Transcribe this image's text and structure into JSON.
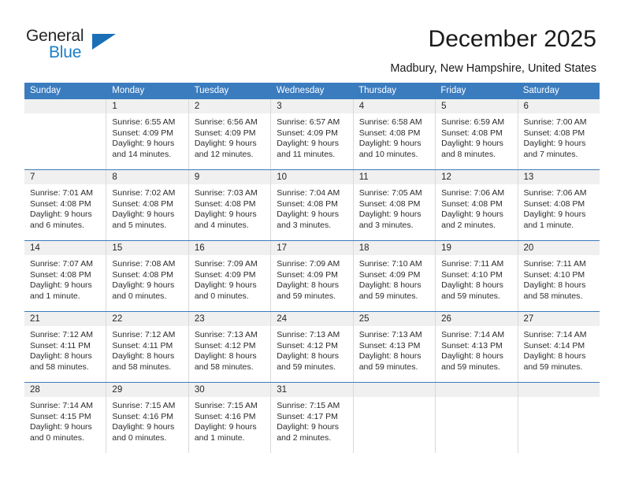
{
  "brand": {
    "name_top": "General",
    "name_bottom": "Blue",
    "accent_color": "#1a7ec8",
    "triangle_color": "#1a6fb5"
  },
  "header": {
    "title": "December 2025",
    "subtitle": "Madbury, New Hampshire, United States",
    "header_bg": "#3b7cbf"
  },
  "weekdays": [
    "Sunday",
    "Monday",
    "Tuesday",
    "Wednesday",
    "Thursday",
    "Friday",
    "Saturday"
  ],
  "labels": {
    "sunrise": "Sunrise:",
    "sunset": "Sunset:",
    "daylight": "Daylight:"
  },
  "weeks": [
    [
      {
        "day": "",
        "blank": true
      },
      {
        "day": "1",
        "sunrise": "Sunrise: 6:55 AM",
        "sunset": "Sunset: 4:09 PM",
        "daylight1": "Daylight: 9 hours",
        "daylight2": "and 14 minutes."
      },
      {
        "day": "2",
        "sunrise": "Sunrise: 6:56 AM",
        "sunset": "Sunset: 4:09 PM",
        "daylight1": "Daylight: 9 hours",
        "daylight2": "and 12 minutes."
      },
      {
        "day": "3",
        "sunrise": "Sunrise: 6:57 AM",
        "sunset": "Sunset: 4:09 PM",
        "daylight1": "Daylight: 9 hours",
        "daylight2": "and 11 minutes."
      },
      {
        "day": "4",
        "sunrise": "Sunrise: 6:58 AM",
        "sunset": "Sunset: 4:08 PM",
        "daylight1": "Daylight: 9 hours",
        "daylight2": "and 10 minutes."
      },
      {
        "day": "5",
        "sunrise": "Sunrise: 6:59 AM",
        "sunset": "Sunset: 4:08 PM",
        "daylight1": "Daylight: 9 hours",
        "daylight2": "and 8 minutes."
      },
      {
        "day": "6",
        "sunrise": "Sunrise: 7:00 AM",
        "sunset": "Sunset: 4:08 PM",
        "daylight1": "Daylight: 9 hours",
        "daylight2": "and 7 minutes."
      }
    ],
    [
      {
        "day": "7",
        "sunrise": "Sunrise: 7:01 AM",
        "sunset": "Sunset: 4:08 PM",
        "daylight1": "Daylight: 9 hours",
        "daylight2": "and 6 minutes."
      },
      {
        "day": "8",
        "sunrise": "Sunrise: 7:02 AM",
        "sunset": "Sunset: 4:08 PM",
        "daylight1": "Daylight: 9 hours",
        "daylight2": "and 5 minutes."
      },
      {
        "day": "9",
        "sunrise": "Sunrise: 7:03 AM",
        "sunset": "Sunset: 4:08 PM",
        "daylight1": "Daylight: 9 hours",
        "daylight2": "and 4 minutes."
      },
      {
        "day": "10",
        "sunrise": "Sunrise: 7:04 AM",
        "sunset": "Sunset: 4:08 PM",
        "daylight1": "Daylight: 9 hours",
        "daylight2": "and 3 minutes."
      },
      {
        "day": "11",
        "sunrise": "Sunrise: 7:05 AM",
        "sunset": "Sunset: 4:08 PM",
        "daylight1": "Daylight: 9 hours",
        "daylight2": "and 3 minutes."
      },
      {
        "day": "12",
        "sunrise": "Sunrise: 7:06 AM",
        "sunset": "Sunset: 4:08 PM",
        "daylight1": "Daylight: 9 hours",
        "daylight2": "and 2 minutes."
      },
      {
        "day": "13",
        "sunrise": "Sunrise: 7:06 AM",
        "sunset": "Sunset: 4:08 PM",
        "daylight1": "Daylight: 9 hours",
        "daylight2": "and 1 minute."
      }
    ],
    [
      {
        "day": "14",
        "sunrise": "Sunrise: 7:07 AM",
        "sunset": "Sunset: 4:08 PM",
        "daylight1": "Daylight: 9 hours",
        "daylight2": "and 1 minute."
      },
      {
        "day": "15",
        "sunrise": "Sunrise: 7:08 AM",
        "sunset": "Sunset: 4:08 PM",
        "daylight1": "Daylight: 9 hours",
        "daylight2": "and 0 minutes."
      },
      {
        "day": "16",
        "sunrise": "Sunrise: 7:09 AM",
        "sunset": "Sunset: 4:09 PM",
        "daylight1": "Daylight: 9 hours",
        "daylight2": "and 0 minutes."
      },
      {
        "day": "17",
        "sunrise": "Sunrise: 7:09 AM",
        "sunset": "Sunset: 4:09 PM",
        "daylight1": "Daylight: 8 hours",
        "daylight2": "and 59 minutes."
      },
      {
        "day": "18",
        "sunrise": "Sunrise: 7:10 AM",
        "sunset": "Sunset: 4:09 PM",
        "daylight1": "Daylight: 8 hours",
        "daylight2": "and 59 minutes."
      },
      {
        "day": "19",
        "sunrise": "Sunrise: 7:11 AM",
        "sunset": "Sunset: 4:10 PM",
        "daylight1": "Daylight: 8 hours",
        "daylight2": "and 59 minutes."
      },
      {
        "day": "20",
        "sunrise": "Sunrise: 7:11 AM",
        "sunset": "Sunset: 4:10 PM",
        "daylight1": "Daylight: 8 hours",
        "daylight2": "and 58 minutes."
      }
    ],
    [
      {
        "day": "21",
        "sunrise": "Sunrise: 7:12 AM",
        "sunset": "Sunset: 4:11 PM",
        "daylight1": "Daylight: 8 hours",
        "daylight2": "and 58 minutes."
      },
      {
        "day": "22",
        "sunrise": "Sunrise: 7:12 AM",
        "sunset": "Sunset: 4:11 PM",
        "daylight1": "Daylight: 8 hours",
        "daylight2": "and 58 minutes."
      },
      {
        "day": "23",
        "sunrise": "Sunrise: 7:13 AM",
        "sunset": "Sunset: 4:12 PM",
        "daylight1": "Daylight: 8 hours",
        "daylight2": "and 58 minutes."
      },
      {
        "day": "24",
        "sunrise": "Sunrise: 7:13 AM",
        "sunset": "Sunset: 4:12 PM",
        "daylight1": "Daylight: 8 hours",
        "daylight2": "and 59 minutes."
      },
      {
        "day": "25",
        "sunrise": "Sunrise: 7:13 AM",
        "sunset": "Sunset: 4:13 PM",
        "daylight1": "Daylight: 8 hours",
        "daylight2": "and 59 minutes."
      },
      {
        "day": "26",
        "sunrise": "Sunrise: 7:14 AM",
        "sunset": "Sunset: 4:13 PM",
        "daylight1": "Daylight: 8 hours",
        "daylight2": "and 59 minutes."
      },
      {
        "day": "27",
        "sunrise": "Sunrise: 7:14 AM",
        "sunset": "Sunset: 4:14 PM",
        "daylight1": "Daylight: 8 hours",
        "daylight2": "and 59 minutes."
      }
    ],
    [
      {
        "day": "28",
        "sunrise": "Sunrise: 7:14 AM",
        "sunset": "Sunset: 4:15 PM",
        "daylight1": "Daylight: 9 hours",
        "daylight2": "and 0 minutes."
      },
      {
        "day": "29",
        "sunrise": "Sunrise: 7:15 AM",
        "sunset": "Sunset: 4:16 PM",
        "daylight1": "Daylight: 9 hours",
        "daylight2": "and 0 minutes."
      },
      {
        "day": "30",
        "sunrise": "Sunrise: 7:15 AM",
        "sunset": "Sunset: 4:16 PM",
        "daylight1": "Daylight: 9 hours",
        "daylight2": "and 1 minute."
      },
      {
        "day": "31",
        "sunrise": "Sunrise: 7:15 AM",
        "sunset": "Sunset: 4:17 PM",
        "daylight1": "Daylight: 9 hours",
        "daylight2": "and 2 minutes."
      },
      {
        "day": "",
        "blank": true
      },
      {
        "day": "",
        "blank": true
      },
      {
        "day": "",
        "blank": true
      }
    ]
  ]
}
